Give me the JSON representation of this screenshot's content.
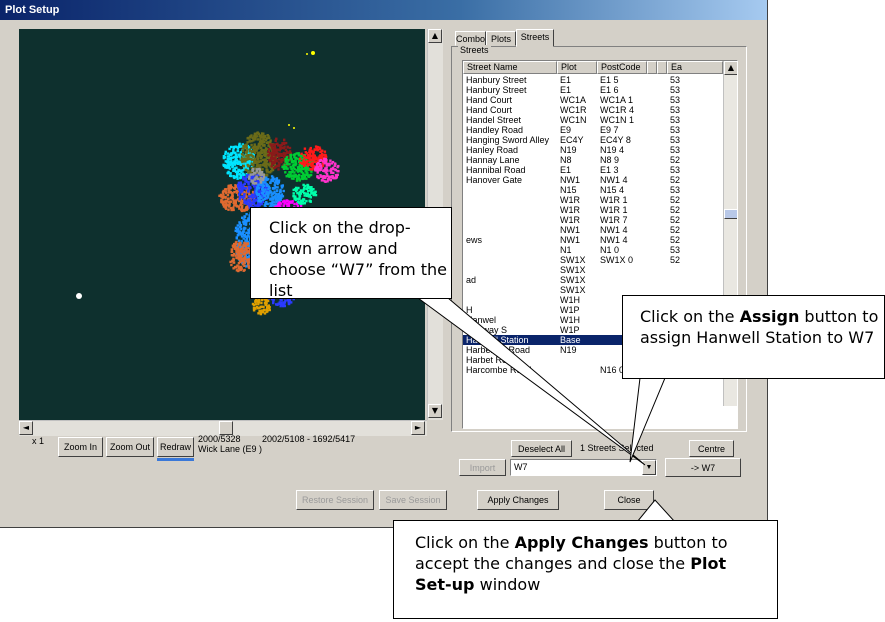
{
  "window": {
    "title": "Plot Setup"
  },
  "plot": {
    "colors": [
      "#00e5ff",
      "#6b6b18",
      "#8b1a1a",
      "#00cc33",
      "#ff1a1a",
      "#ff33cc",
      "#e06a30",
      "#2a3aff",
      "#1a8fff",
      "#cccc00",
      "#ff00ff",
      "#999999",
      "#e0a000",
      "#00ffaa",
      "#ffff00"
    ]
  },
  "bottom_bar": {
    "zoom": "x 1",
    "zoom_in": "Zoom In",
    "zoom_out": "Zoom Out",
    "redraw": "Redraw",
    "coord1": "2000/5328",
    "coord2": "2002/5108 - 1692/5417",
    "location": "Wick Lane (E9 )"
  },
  "tabs": [
    "Combo",
    "Plots",
    "Streets"
  ],
  "streets_group_label": "Streets",
  "columns": [
    "Street Name",
    "Plot",
    "PostCode",
    "",
    "",
    "Ea"
  ],
  "rows": [
    [
      "Hanbury Street",
      "E1",
      "E1 5",
      "53"
    ],
    [
      "Hanbury Street",
      "E1",
      "E1 6",
      "53"
    ],
    [
      "Hand Court",
      "WC1A",
      "WC1A 1",
      "53"
    ],
    [
      "Hand Court",
      "WC1R",
      "WC1R 4",
      "53"
    ],
    [
      "Handel Street",
      "WC1N",
      "WC1N 1",
      "53"
    ],
    [
      "Handley Road",
      "E9",
      "E9 7",
      "53"
    ],
    [
      "Hanging Sword Alley",
      "EC4Y",
      "EC4Y 8",
      "53"
    ],
    [
      "Hanley Road",
      "N19",
      "N19 4",
      "53"
    ],
    [
      "Hannay Lane",
      "N8",
      "N8 9",
      "52"
    ],
    [
      "Hannibal Road",
      "E1",
      "E1 3",
      "53"
    ],
    [
      "Hanover Gate",
      "NW1",
      "NW1 4",
      "52"
    ],
    [
      "",
      "N15",
      "N15 4",
      "53"
    ],
    [
      "",
      "W1R",
      "W1R 1",
      "52"
    ],
    [
      "",
      "W1R",
      "W1R 1",
      "52"
    ],
    [
      "",
      "W1R",
      "W1R 7",
      "52"
    ],
    [
      "",
      "NW1",
      "NW1 4",
      "52"
    ],
    [
      "ews",
      "NW1",
      "NW1 4",
      "52"
    ],
    [
      "",
      "N1",
      "N1 0",
      "53"
    ],
    [
      "",
      "SW1X",
      "SW1X 0",
      "52"
    ],
    [
      "",
      "SW1X",
      "",
      ""
    ],
    [
      "ad",
      "SW1X",
      "",
      ""
    ],
    [
      "",
      "SW1X",
      "",
      ""
    ],
    [
      "",
      "W1H",
      "",
      ""
    ],
    [
      "H",
      "W1P",
      "",
      ""
    ],
    [
      "Hanwel",
      "W1H",
      "",
      ""
    ],
    [
      "Hanway S",
      "W1P",
      "",
      ""
    ],
    [
      "Hanwell Station",
      "Base",
      "",
      ""
    ],
    [
      "Harberton Road",
      "N19",
      "",
      ""
    ],
    [
      "Harbet Road",
      "",
      "",
      ""
    ],
    [
      "Harcombe Road",
      "",
      "N16 0",
      ""
    ]
  ],
  "buttons": {
    "deselect_all": "Deselect All",
    "streets_selected": "1 Streets Selected",
    "centre": "Centre",
    "import": "Import",
    "assign": "-> W7",
    "restore_session": "Restore Session",
    "save_session": "Save Session",
    "apply_changes": "Apply Changes",
    "close": "Close"
  },
  "plot_combo": {
    "value": "W7"
  },
  "callouts": {
    "dropdown": "Click on the drop-down arrow and choose “W7” from the list",
    "assign_pre": "Click on the ",
    "assign_bold": "Assign",
    "assign_post": " button to assign Hanwell Station to W7",
    "apply_pre": "Click on the ",
    "apply_bold": "Apply Changes",
    "apply_mid": " button to accept the changes and close the ",
    "apply_bold2": "Plot Set-up",
    "apply_post": " window"
  }
}
